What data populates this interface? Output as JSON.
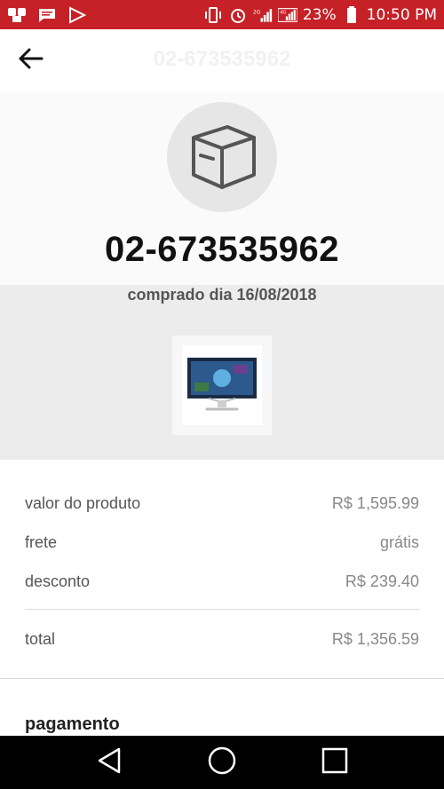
{
  "status_bar": {
    "battery": "23%",
    "time": "10:50 PM",
    "network_labels": [
      "2G",
      "4G"
    ],
    "bg_color": "#c62127"
  },
  "header": {
    "title": "02-673535962"
  },
  "order": {
    "number": "02-673535962",
    "purchase_date": "comprado dia 16/08/2018"
  },
  "summary": {
    "rows": [
      {
        "label": "valor do produto",
        "value": "R$ 1,595.99"
      },
      {
        "label": "frete",
        "value": "grátis"
      },
      {
        "label": "desconto",
        "value": "R$ 239.40"
      }
    ],
    "total": {
      "label": "total",
      "value": "R$ 1,356.59"
    }
  },
  "payment": {
    "title": "pagamento"
  },
  "icons": {
    "back": "arrow-left-icon",
    "order": "box-icon",
    "nav": [
      "back-triangle-icon",
      "home-circle-icon",
      "recents-square-icon"
    ]
  }
}
